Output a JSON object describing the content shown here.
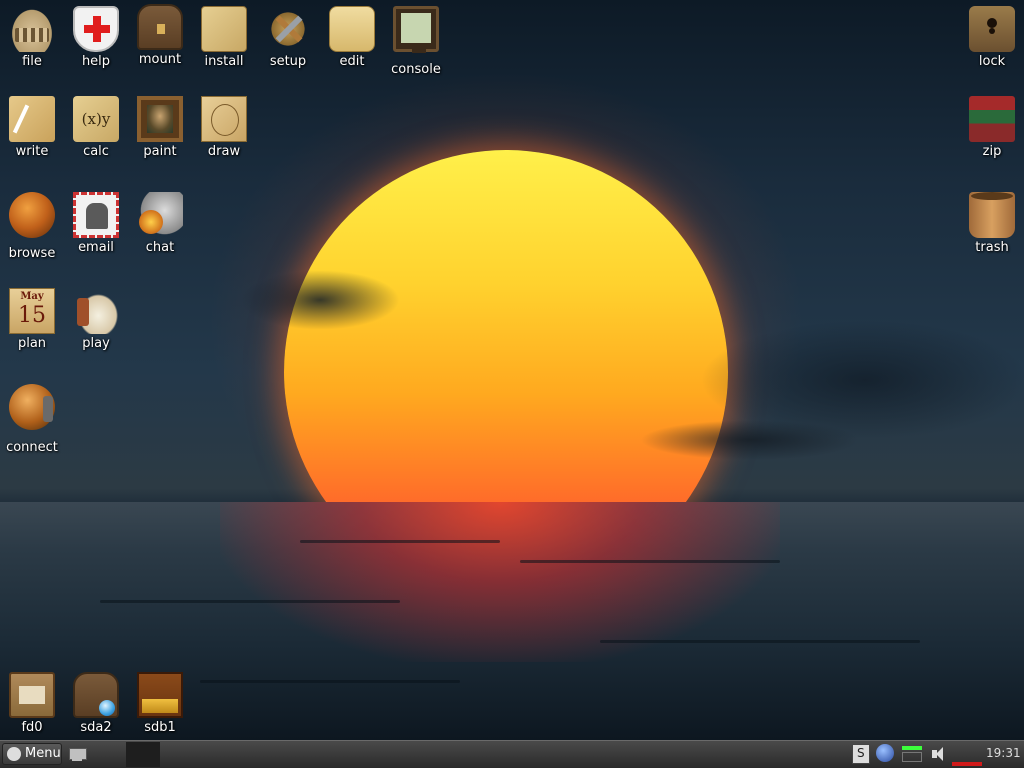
{
  "desktop": {
    "icons": [
      {
        "id": "file",
        "label": "file",
        "icon": "colosseum-icon"
      },
      {
        "id": "help",
        "label": "help",
        "icon": "red-cross-shield-icon"
      },
      {
        "id": "mount",
        "label": "mount",
        "icon": "treasure-chest-icon"
      },
      {
        "id": "install",
        "label": "install",
        "icon": "parchment-package-icon"
      },
      {
        "id": "setup",
        "label": "setup",
        "icon": "crossed-tools-icon"
      },
      {
        "id": "edit",
        "label": "edit",
        "icon": "scroll-quill-icon"
      },
      {
        "id": "console",
        "label": "console",
        "icon": "monitor-icon"
      },
      {
        "id": "lock",
        "label": "lock",
        "icon": "keyhole-icon"
      },
      {
        "id": "write",
        "label": "write",
        "icon": "quill-paper-icon"
      },
      {
        "id": "calc",
        "label": "calc",
        "icon": "calc-parchment-icon",
        "glyph": "(x)y"
      },
      {
        "id": "paint",
        "label": "paint",
        "icon": "framed-painting-icon"
      },
      {
        "id": "draw",
        "label": "draw",
        "icon": "vitruvian-man-icon"
      },
      {
        "id": "zip",
        "label": "zip",
        "icon": "book-stack-icon"
      },
      {
        "id": "browse",
        "label": "browse",
        "icon": "globe-icon"
      },
      {
        "id": "email",
        "label": "email",
        "icon": "postage-stamp-icon"
      },
      {
        "id": "chat",
        "label": "chat",
        "icon": "knight-helmet-icon"
      },
      {
        "id": "trash",
        "label": "trash",
        "icon": "wooden-bucket-icon"
      },
      {
        "id": "plan",
        "label": "plan",
        "icon": "calendar-icon",
        "month": "May",
        "day": "15"
      },
      {
        "id": "play",
        "label": "play",
        "icon": "lute-icon"
      },
      {
        "id": "connect",
        "label": "connect",
        "icon": "globe-phone-icon"
      },
      {
        "id": "fd0",
        "label": "fd0",
        "icon": "floppy-drive-icon"
      },
      {
        "id": "sda2",
        "label": "sda2",
        "icon": "chest-disk-icon"
      },
      {
        "id": "sdb1",
        "label": "sdb1",
        "icon": "drawer-drive-icon"
      }
    ]
  },
  "taskbar": {
    "menu_label": "Menu",
    "clock": "19:31"
  }
}
